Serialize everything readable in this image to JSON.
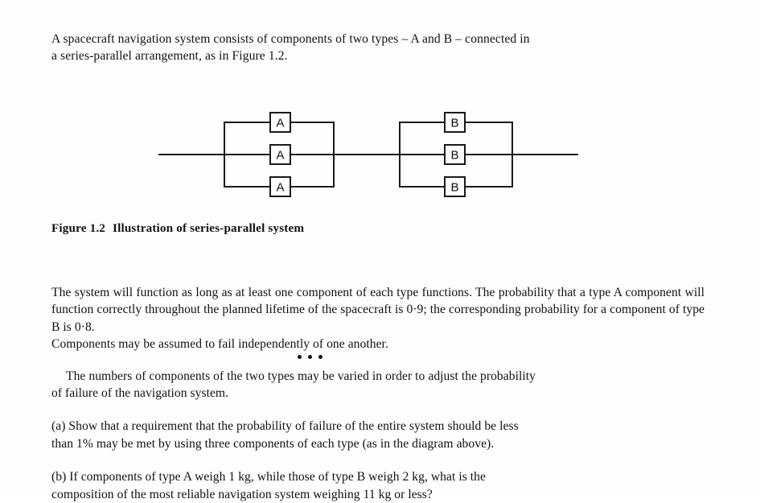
{
  "document": {
    "intro": {
      "line1": "A spacecraft navigation system consists of components of two types – A and B – connected in",
      "line2": "a series-parallel arrangement, as in Figure 1.2."
    },
    "figure": {
      "caption_number": "Figure 1.2",
      "caption_text": "Illustration of series-parallel system",
      "block_a": {
        "label": "A",
        "component_label": "A",
        "count": 3,
        "components": [
          "A",
          "A",
          "A"
        ]
      },
      "block_b": {
        "label": "B",
        "component_label": "B",
        "count": 3,
        "components": [
          "B",
          "B",
          "B"
        ]
      },
      "arrangement": "series-parallel",
      "line_color": "#1a1a1a"
    },
    "paragraphs": {
      "p1_line1": "The system will function as long as at least one component of each type functions.  The",
      "p1_line2": "probability that a type A component will function correctly throughout the planned lifetime of",
      "p1_line3": "the spacecraft is 0·9; the corresponding probability for a component of type B is 0·8.",
      "p1_line4": "Components may be assumed to fail independently of one another.",
      "p2_line1": "The numbers of components of the two types may be varied in order to adjust the probability",
      "p2_line2": "of failure of the navigation system.",
      "pa_line1": "(a)  Show that a requirement that the probability of failure of the entire system should be less",
      "pa_line2": "than 1% may be met by using three components of each type (as in the diagram above).",
      "pb_line1": "(b)  If components of type A weigh 1 kg, while those of type B weigh 2 kg, what is the",
      "pb_line2": "composition of the most reliable navigation system weighing 11 kg or less?"
    },
    "values": {
      "prob_type_a": "0·9",
      "prob_type_b": "0·8",
      "failure_threshold": "1%",
      "weight_a": "1 kg",
      "weight_b": "2 kg",
      "weight_limit": "11 kg",
      "components_each_type": "three"
    },
    "annotation": {
      "dots_mark": "•••"
    }
  }
}
